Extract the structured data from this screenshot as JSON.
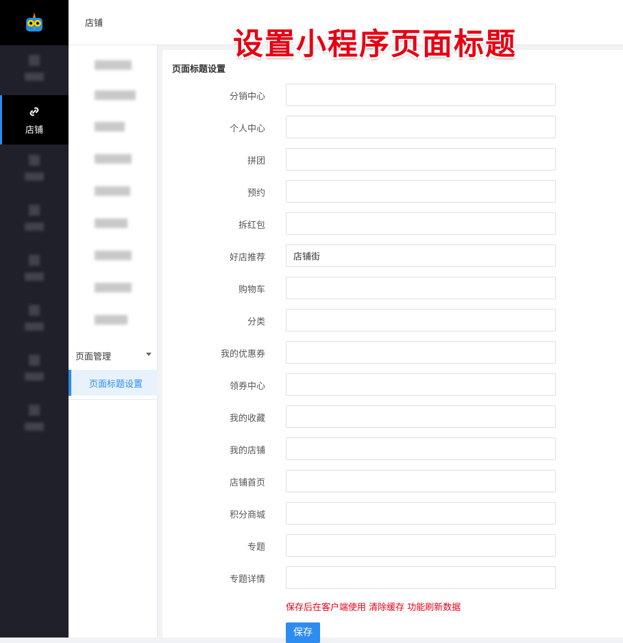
{
  "rail": {
    "active_label": "店铺"
  },
  "header": {
    "breadcrumb": "店铺",
    "overlay_title": "设置小程序页面标题"
  },
  "subnav": {
    "group_label": "页面管理",
    "active_item": "页面标题设置"
  },
  "panel": {
    "title": "页面标题设置",
    "fields": [
      {
        "label": "分销中心",
        "value": ""
      },
      {
        "label": "个人中心",
        "value": ""
      },
      {
        "label": "拼团",
        "value": ""
      },
      {
        "label": "预约",
        "value": ""
      },
      {
        "label": "拆红包",
        "value": ""
      },
      {
        "label": "好店推荐",
        "value": "店铺街"
      },
      {
        "label": "购物车",
        "value": ""
      },
      {
        "label": "分类",
        "value": ""
      },
      {
        "label": "我的优惠券",
        "value": ""
      },
      {
        "label": "领券中心",
        "value": ""
      },
      {
        "label": "我的收藏",
        "value": ""
      },
      {
        "label": "我的店铺",
        "value": ""
      },
      {
        "label": "店铺首页",
        "value": ""
      },
      {
        "label": "积分商城",
        "value": ""
      },
      {
        "label": "专题",
        "value": ""
      },
      {
        "label": "专题详情",
        "value": ""
      }
    ],
    "note": "保存后在客户端使用 清除缓存 功能刷新数据",
    "save_label": "保存"
  },
  "colors": {
    "accent": "#2d8cf0",
    "rail_bg": "#1f2029",
    "note": "#e60012"
  }
}
